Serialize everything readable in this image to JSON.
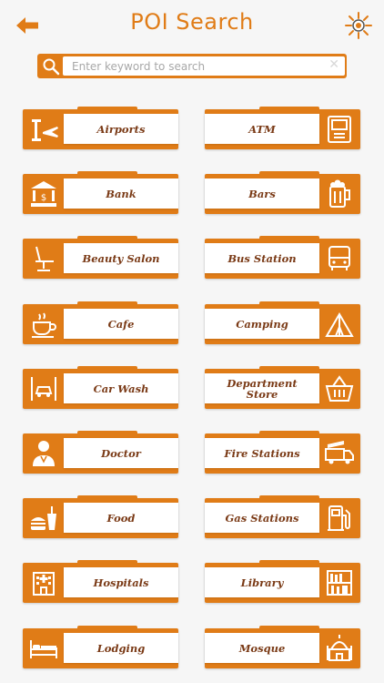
{
  "header": {
    "title": "POI Search"
  },
  "search": {
    "placeholder": "Enter keyword to search",
    "clear_label": "✕"
  },
  "categories": [
    {
      "label": "Airports",
      "icon": "airport-icon"
    },
    {
      "label": "ATM",
      "icon": "atm-icon"
    },
    {
      "label": "Bank",
      "icon": "bank-icon"
    },
    {
      "label": "Bars",
      "icon": "beer-icon"
    },
    {
      "label": "Beauty Salon",
      "icon": "salon-chair-icon"
    },
    {
      "label": "Bus Station",
      "icon": "bus-icon"
    },
    {
      "label": "Cafe",
      "icon": "coffee-cup-icon"
    },
    {
      "label": "Camping",
      "icon": "tent-icon"
    },
    {
      "label": "Car Wash",
      "icon": "car-wash-icon"
    },
    {
      "label": "Department Store",
      "icon": "basket-icon"
    },
    {
      "label": "Doctor",
      "icon": "doctor-icon"
    },
    {
      "label": "Fire Stations",
      "icon": "fire-truck-icon"
    },
    {
      "label": "Food",
      "icon": "burger-drink-icon"
    },
    {
      "label": "Gas Stations",
      "icon": "fuel-pump-icon"
    },
    {
      "label": "Hospitals",
      "icon": "hospital-icon"
    },
    {
      "label": "Library",
      "icon": "bookshelf-icon"
    },
    {
      "label": "Lodging",
      "icon": "bed-icon"
    },
    {
      "label": "Mosque",
      "icon": "mosque-icon"
    }
  ],
  "colors": {
    "accent": "#e07c17",
    "label_text": "#7a3a16",
    "background": "#f6f6f6"
  }
}
